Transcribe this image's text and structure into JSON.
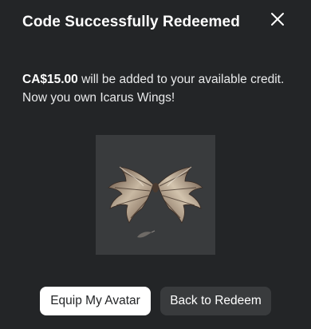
{
  "dialog": {
    "title": "Code Successfully Redeemed",
    "close_icon": "close-icon",
    "message": {
      "amount": "CA$15.00",
      "line1_rest": " will be added to your available credit.",
      "line2": "Now you own Icarus Wings!"
    },
    "item": {
      "image_icon": "icarus-wings-image"
    },
    "buttons": {
      "equip_label": "Equip My Avatar",
      "back_label": "Back to Redeem"
    }
  },
  "colors": {
    "background": "#232527",
    "thumbnail_background": "#393b3d",
    "primary_button": "#ffffff",
    "secondary_button": "#393b3d"
  }
}
